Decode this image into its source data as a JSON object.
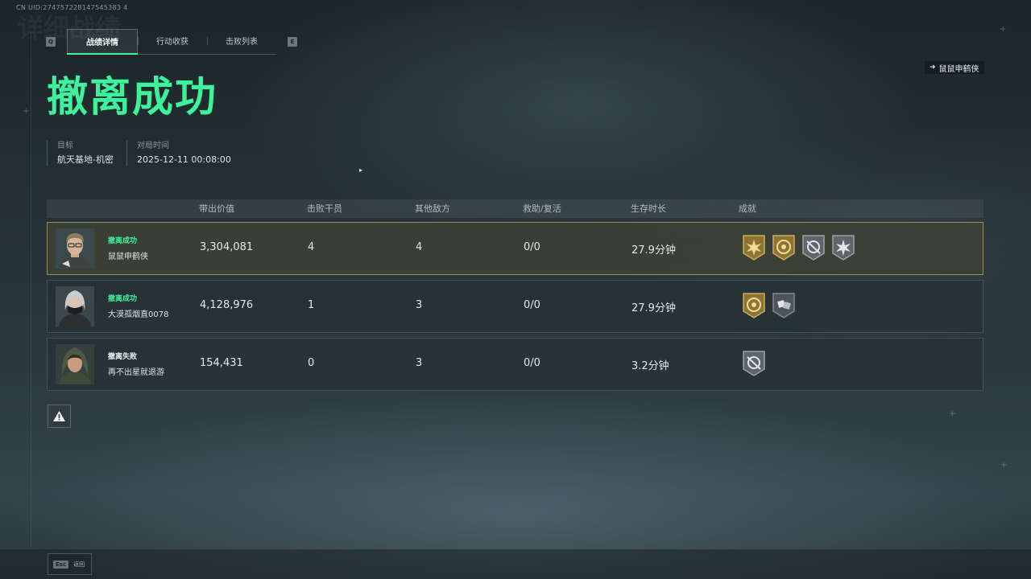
{
  "uid": "CN UID:274757228147545383 4",
  "ghost_title": "详细战绩",
  "tabs": {
    "prev_key": "Q",
    "next_key": "E",
    "items": [
      {
        "label": "战绩详情",
        "active": true
      },
      {
        "label": "行动收获",
        "active": false
      },
      {
        "label": "击败列表",
        "active": false
      }
    ]
  },
  "player_tag": {
    "icon": "arrow-icon",
    "name": "鼠鼠申鹤侠"
  },
  "result_title": "撤离成功",
  "info": {
    "target_label": "目标",
    "target_value": "航天基地-机密",
    "time_label": "对局时间",
    "time_value": "2025-12-11 00:08:00"
  },
  "table": {
    "headers": [
      "带出价值",
      "击败干员",
      "其他敌方",
      "救助/复活",
      "生存时长",
      "成就"
    ],
    "rows": [
      {
        "status": "撤离成功",
        "status_color": "#3df29b",
        "name": "鼠鼠申鹤侠",
        "value": "3,304,081",
        "kills": "4",
        "other": "4",
        "assist": "0/0",
        "survival": "27.9分钟",
        "badges": [
          "gold-star-badge-icon",
          "gold-medal-badge-icon",
          "silver-crosshair-badge-icon",
          "silver-star-badge-icon"
        ],
        "highlight": true,
        "avatar": "male-glasses-avatar"
      },
      {
        "status": "撤离成功",
        "status_color": "#3df29b",
        "name": "大漠孤烟直0078",
        "value": "4,128,976",
        "kills": "1",
        "other": "3",
        "assist": "0/0",
        "survival": "27.9分钟",
        "badges": [
          "gold-medal-badge-icon",
          "silver-dice-badge-icon"
        ],
        "highlight": false,
        "avatar": "white-hair-masked-avatar"
      },
      {
        "status": "撤离失败",
        "status_color": "#f0f3f4",
        "name": "再不出星就退游",
        "value": "154,431",
        "kills": "0",
        "other": "3",
        "assist": "0/0",
        "survival": "3.2分钟",
        "badges": [
          "silver-crosshair-badge-icon"
        ],
        "highlight": false,
        "avatar": "hooded-female-avatar"
      }
    ]
  },
  "warning_icon": "warning-icon",
  "esc": {
    "key": "Esc",
    "label": "返回"
  },
  "colors": {
    "accent": "#3df29b",
    "highlight_border": "#b8b278",
    "gold": "#b99a4b",
    "silver": "#8b9295"
  }
}
